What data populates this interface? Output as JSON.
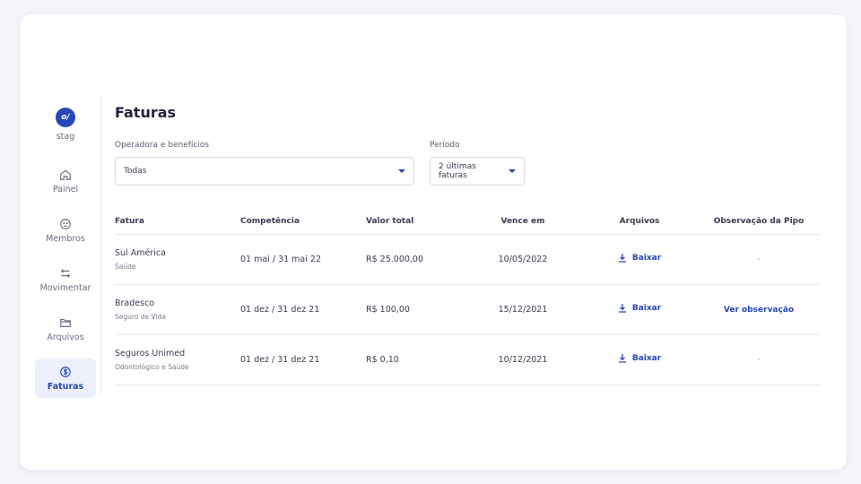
{
  "brand": {
    "logo_text": "o/",
    "env_label": "stag"
  },
  "sidebar": {
    "items": [
      {
        "label": "Painel",
        "icon": "home-icon",
        "active": false
      },
      {
        "label": "Membros",
        "icon": "face-icon",
        "active": false
      },
      {
        "label": "Movimentar",
        "icon": "swap-icon",
        "active": false
      },
      {
        "label": "Arquivos",
        "icon": "folder-icon",
        "active": false
      },
      {
        "label": "Faturas",
        "icon": "dollar-icon",
        "active": true
      }
    ]
  },
  "page": {
    "title": "Faturas"
  },
  "filters": {
    "operadora": {
      "label": "Operadora e benefícios",
      "value": "Todas"
    },
    "periodo": {
      "label": "Período",
      "value": "2 últimas faturas"
    }
  },
  "table": {
    "headers": [
      "Fatura",
      "Competência",
      "Valor total",
      "Vence em",
      "Arquivos",
      "Observação da Pipo"
    ],
    "rows": [
      {
        "name": "Sul América",
        "sub": "Saúde",
        "competencia": "01 mai / 31 mai 22",
        "valor": "R$ 25.000,00",
        "vence": "10/05/2022",
        "arquivo": "Baixar",
        "obs": "-"
      },
      {
        "name": "Bradesco",
        "sub": "Seguro de Vida",
        "competencia": "01 dez / 31 dez 21",
        "valor": "R$ 100,00",
        "vence": "15/12/2021",
        "arquivo": "Baixar",
        "obs": "Ver observação"
      },
      {
        "name": "Seguros Unimed",
        "sub": "Odontológico e Saúde",
        "competencia": "01 dez / 31 dez 21",
        "valor": "R$ 0,10",
        "vence": "10/12/2021",
        "arquivo": "Baixar",
        "obs": "-"
      }
    ]
  },
  "colors": {
    "accent": "#2846b8",
    "active_bg": "#edf0fb"
  }
}
